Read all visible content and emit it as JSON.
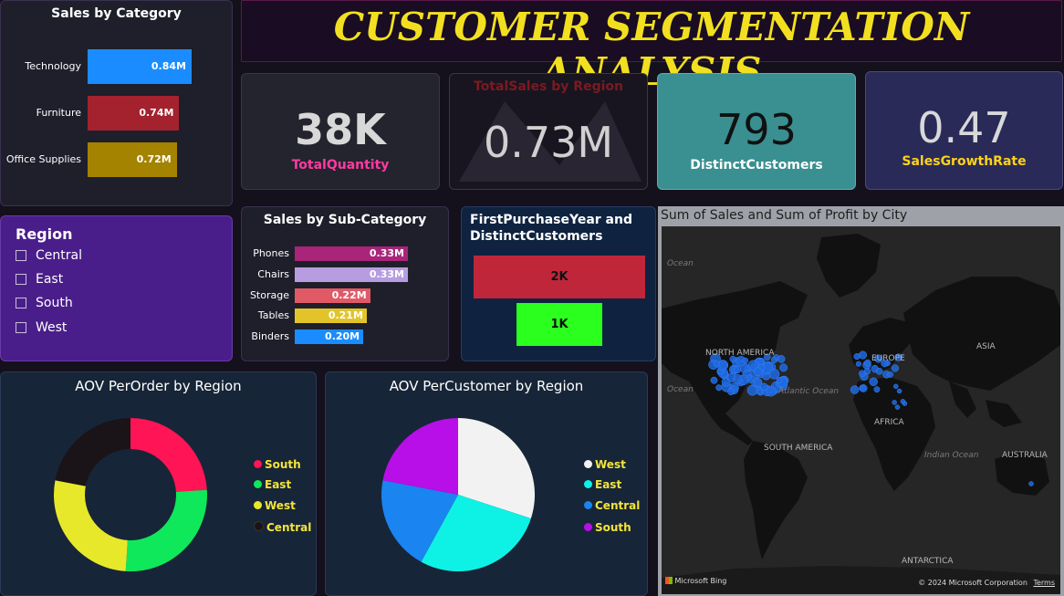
{
  "title": "CUSTOMER SEGMENTATION ANALYSIS",
  "sales_by_category": {
    "title": "Sales by Category",
    "rows": [
      {
        "label": "Technology",
        "value": 0.84,
        "display": "0.84M",
        "color": "#1a8cff"
      },
      {
        "label": "Furniture",
        "value": 0.74,
        "display": "0.74M",
        "color": "#a3222e"
      },
      {
        "label": "Office Supplies",
        "value": 0.72,
        "display": "0.72M",
        "color": "#a38300"
      }
    ]
  },
  "kpis": {
    "total_quantity": {
      "value": "38K",
      "label": "TotalQuantity"
    },
    "total_sales_region": {
      "value": "0.73M",
      "label": "TotalSales by Region"
    },
    "distinct_customers": {
      "value": "793",
      "label": "DistinctCustomers"
    },
    "sales_growth": {
      "value": "0.47",
      "label": "SalesGrowthRate"
    }
  },
  "region_slicer": {
    "title": "Region",
    "items": [
      "Central",
      "East",
      "South",
      "West"
    ]
  },
  "sales_by_subcategory": {
    "title": "Sales by Sub-Category",
    "rows": [
      {
        "label": "Phones",
        "value": 0.33,
        "display": "0.33M",
        "color": "#a8257a"
      },
      {
        "label": "Chairs",
        "value": 0.33,
        "display": "0.33M",
        "color": "#b79de0"
      },
      {
        "label": "Storage",
        "value": 0.22,
        "display": "0.22M",
        "color": "#e05a66"
      },
      {
        "label": "Tables",
        "value": 0.21,
        "display": "0.21M",
        "color": "#e2c42a"
      },
      {
        "label": "Binders",
        "value": 0.2,
        "display": "0.20M",
        "color": "#1a8cff"
      }
    ]
  },
  "first_purchase": {
    "title": "FirstPurchaseYear and DistinctCustomers",
    "bars": [
      {
        "display": "2K",
        "value": 2000,
        "color": "#c0263a"
      },
      {
        "display": "1K",
        "value": 1000,
        "color": "#2bff1e"
      }
    ]
  },
  "aov_per_order": {
    "title": "AOV PerOrder by Region",
    "legend": [
      {
        "label": "South",
        "color": "#ff1455"
      },
      {
        "label": "East",
        "color": "#0fe85a"
      },
      {
        "label": "West",
        "color": "#e8e82a"
      },
      {
        "label": "Central",
        "color": "#1a1418"
      }
    ]
  },
  "aov_per_customer": {
    "title": "AOV PerCustomer by Region",
    "legend": [
      {
        "label": "West",
        "color": "#f2f2f2"
      },
      {
        "label": "East",
        "color": "#0ef2e6"
      },
      {
        "label": "Central",
        "color": "#1a84f0"
      },
      {
        "label": "South",
        "color": "#b80ee8"
      }
    ]
  },
  "chart_data": [
    {
      "type": "pie",
      "title": "AOV PerOrder by Region",
      "categories": [
        "South",
        "East",
        "West",
        "Central"
      ],
      "values": [
        0.24,
        0.27,
        0.27,
        0.22
      ],
      "donut": true
    },
    {
      "type": "pie",
      "title": "AOV PerCustomer by Region",
      "categories": [
        "West",
        "East",
        "Central",
        "South"
      ],
      "values": [
        0.3,
        0.28,
        0.2,
        0.22
      ]
    }
  ],
  "map": {
    "title": "Sum of Sales and Sum of Profit by City",
    "labels": {
      "north_america": "NORTH AMERICA",
      "europe": "EUROPE",
      "asia": "ASIA",
      "africa": "AFRICA",
      "south_america": "SOUTH AMERICA",
      "australia": "AUSTRALIA",
      "antarctica": "ANTARCTICA",
      "ocean1": "Ocean",
      "ocean2": "Ocean",
      "atlantic": "Atlantic Ocean",
      "indian": "Indian Ocean"
    },
    "bing": "Microsoft Bing",
    "copyright": "© 2024 Microsoft Corporation",
    "terms": "Terms"
  }
}
